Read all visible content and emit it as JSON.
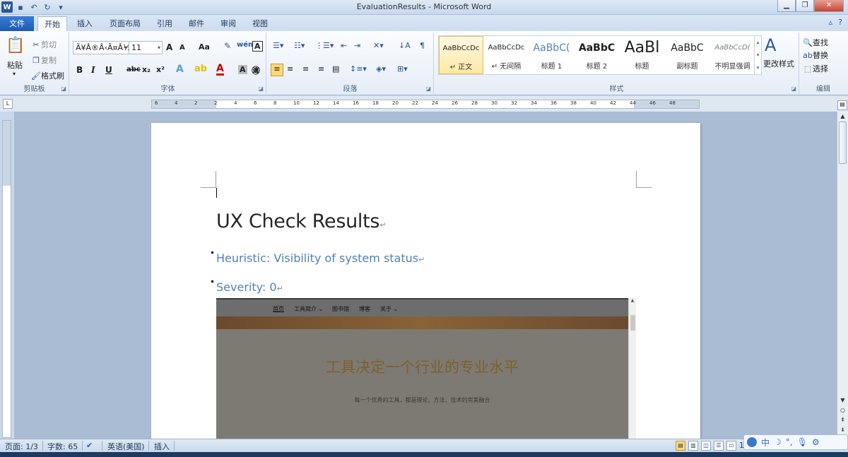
{
  "window": {
    "title": "EvaluationResults - Microsoft Word"
  },
  "tabs": {
    "file": "文件",
    "items": [
      "开始",
      "插入",
      "页面布局",
      "引用",
      "邮件",
      "审阅",
      "视图"
    ]
  },
  "clipboard": {
    "paste": "粘贴",
    "cut": "剪切",
    "copy": "复制",
    "format_painter": "格式刷",
    "label": "剪贴板"
  },
  "font": {
    "name": "Ã¥Â®Â‹Ã¤Â½",
    "size": "11",
    "label": "字体",
    "grow": "A",
    "shrink": "A",
    "case": "Aa",
    "bold": "B",
    "italic": "I",
    "underline": "U",
    "strike": "abc",
    "sub": "x₂",
    "sup": "x²"
  },
  "paragraph": {
    "label": "段落"
  },
  "styles": {
    "label": "样式",
    "items": [
      {
        "sample": "AaBbCcDc",
        "name": "↵ 正文"
      },
      {
        "sample": "AaBbCcDc",
        "name": "↵ 无间隔"
      },
      {
        "sample": "AaBbC(",
        "name": "标题 1"
      },
      {
        "sample": "AaBbC",
        "name": "标题 2"
      },
      {
        "sample": "AaBl",
        "name": "标题"
      },
      {
        "sample": "AaBbC",
        "name": "副标题"
      },
      {
        "sample": "AaBbCcD(",
        "name": "不明显强调"
      }
    ],
    "change": "更改样式"
  },
  "editing": {
    "label": "编辑",
    "find": "查找",
    "replace": "替换",
    "select": "选择"
  },
  "ruler": {
    "ticks": [
      "6",
      "4",
      "2",
      "2",
      "4",
      "6",
      "8",
      "10",
      "12",
      "14",
      "16",
      "18",
      "20",
      "22",
      "24",
      "26",
      "28",
      "30",
      "32",
      "34",
      "36",
      "38",
      "40",
      "42",
      "44",
      "46",
      "48"
    ]
  },
  "document": {
    "title": "UX Check Results",
    "heuristic": "Heuristic: Visibility of system status",
    "severity": "Severity: 0",
    "para_mark": "↵"
  },
  "embedded_site": {
    "nav": [
      "首页",
      "工具简介 ⌄",
      "图书馆",
      "博客",
      "关于 ⌄"
    ],
    "hero": "工具决定一个行业的专业水平",
    "sub": "每一个优秀的工具，都是理论、方法、技术的完美融合"
  },
  "status": {
    "page": "页面: 1/3",
    "words": "字数: 65",
    "language": "英语(美国)",
    "mode": "插入",
    "zoom": "10"
  },
  "ime": {
    "chars": [
      "中",
      "☽",
      "°,",
      "🎙",
      "⚙"
    ]
  }
}
